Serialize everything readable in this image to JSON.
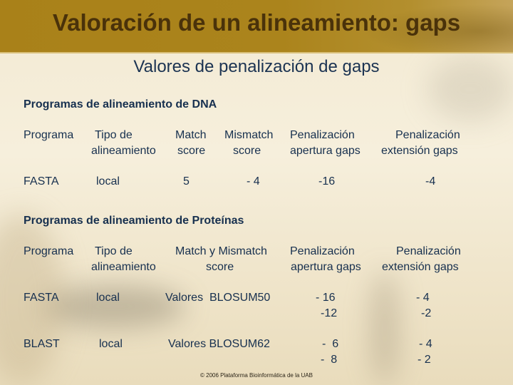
{
  "title": "Valoración de un alineamiento: gaps",
  "subtitle": "Valores de penalización de gaps",
  "dna": {
    "heading": "Programas de alineamiento de DNA",
    "headers": {
      "programa": "Programa",
      "tipo_1": "Tipo de",
      "tipo_2": "alineamiento",
      "match_1": "Match",
      "match_2": "score",
      "mismatch_1": "Mismatch",
      "mismatch_2": "score",
      "apertura_1": "Penalización",
      "apertura_2": "apertura gaps",
      "extension_1": "Penalización",
      "extension_2": "extensión gaps"
    },
    "rows": [
      {
        "programa": "FASTA",
        "tipo": "local",
        "match": "5",
        "mismatch": "- 4",
        "apertura": "-16",
        "extension": "-4"
      }
    ]
  },
  "proteins": {
    "heading": "Programas de alineamiento de Proteínas",
    "headers": {
      "programa": "Programa",
      "tipo_1": "Tipo de",
      "tipo_2": "alineamiento",
      "score_1": "Match y Mismatch",
      "score_2": "score",
      "apertura_1": "Penalización",
      "apertura_2": "apertura gaps",
      "extension_1": "Penalización",
      "extension_2": "extensión gaps"
    },
    "rows": [
      {
        "programa": "FASTA",
        "tipo": "local",
        "score": "Valores  BLOSUM50",
        "apertura_1": "- 16",
        "apertura_2": "-12",
        "extension_1": "- 4",
        "extension_2": "-2"
      },
      {
        "programa": "BLAST",
        "tipo": "local",
        "score": "Valores BLOSUM62",
        "apertura_1": "-  6",
        "apertura_2": "-  8",
        "extension_1": "- 4",
        "extension_2": "- 2"
      }
    ]
  },
  "footer": "© 2006 Plataforma Bioinformática de la UAB"
}
